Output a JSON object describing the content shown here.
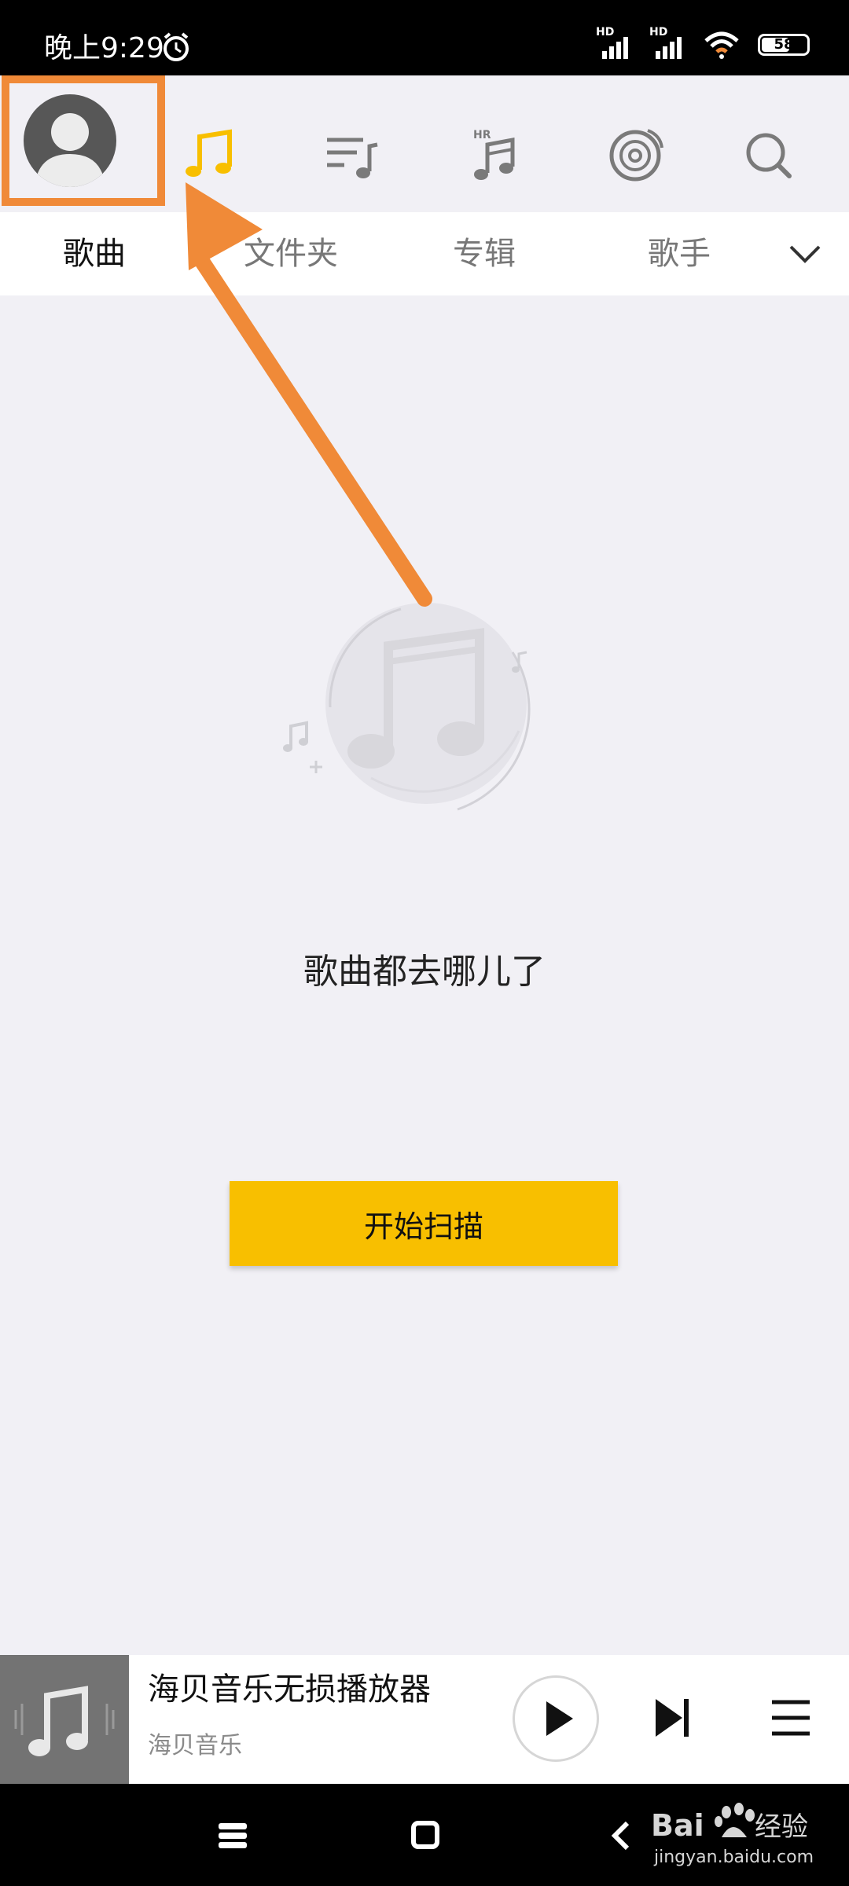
{
  "status_bar": {
    "time": "晚上9:29",
    "network_1": "HD",
    "network_2": "HD",
    "battery": "58"
  },
  "tabs": {
    "items": [
      {
        "label": "歌曲",
        "active": true
      },
      {
        "label": "文件夹",
        "active": false
      },
      {
        "label": "专辑",
        "active": false
      },
      {
        "label": "歌手",
        "active": false
      }
    ]
  },
  "nav_icons": {
    "hr_label": "HR"
  },
  "empty_state": {
    "message": "歌曲都去哪儿了",
    "scan_button": "开始扫描"
  },
  "player": {
    "title": "海贝音乐无损播放器",
    "artist": "海贝音乐"
  },
  "watermark": {
    "brand": "Bai",
    "brand_cn": "经验",
    "url": "jingyan.baidu.com"
  },
  "colors": {
    "accent": "#f8bf00",
    "highlight": "#f08a38",
    "background": "#f1f0f5"
  }
}
